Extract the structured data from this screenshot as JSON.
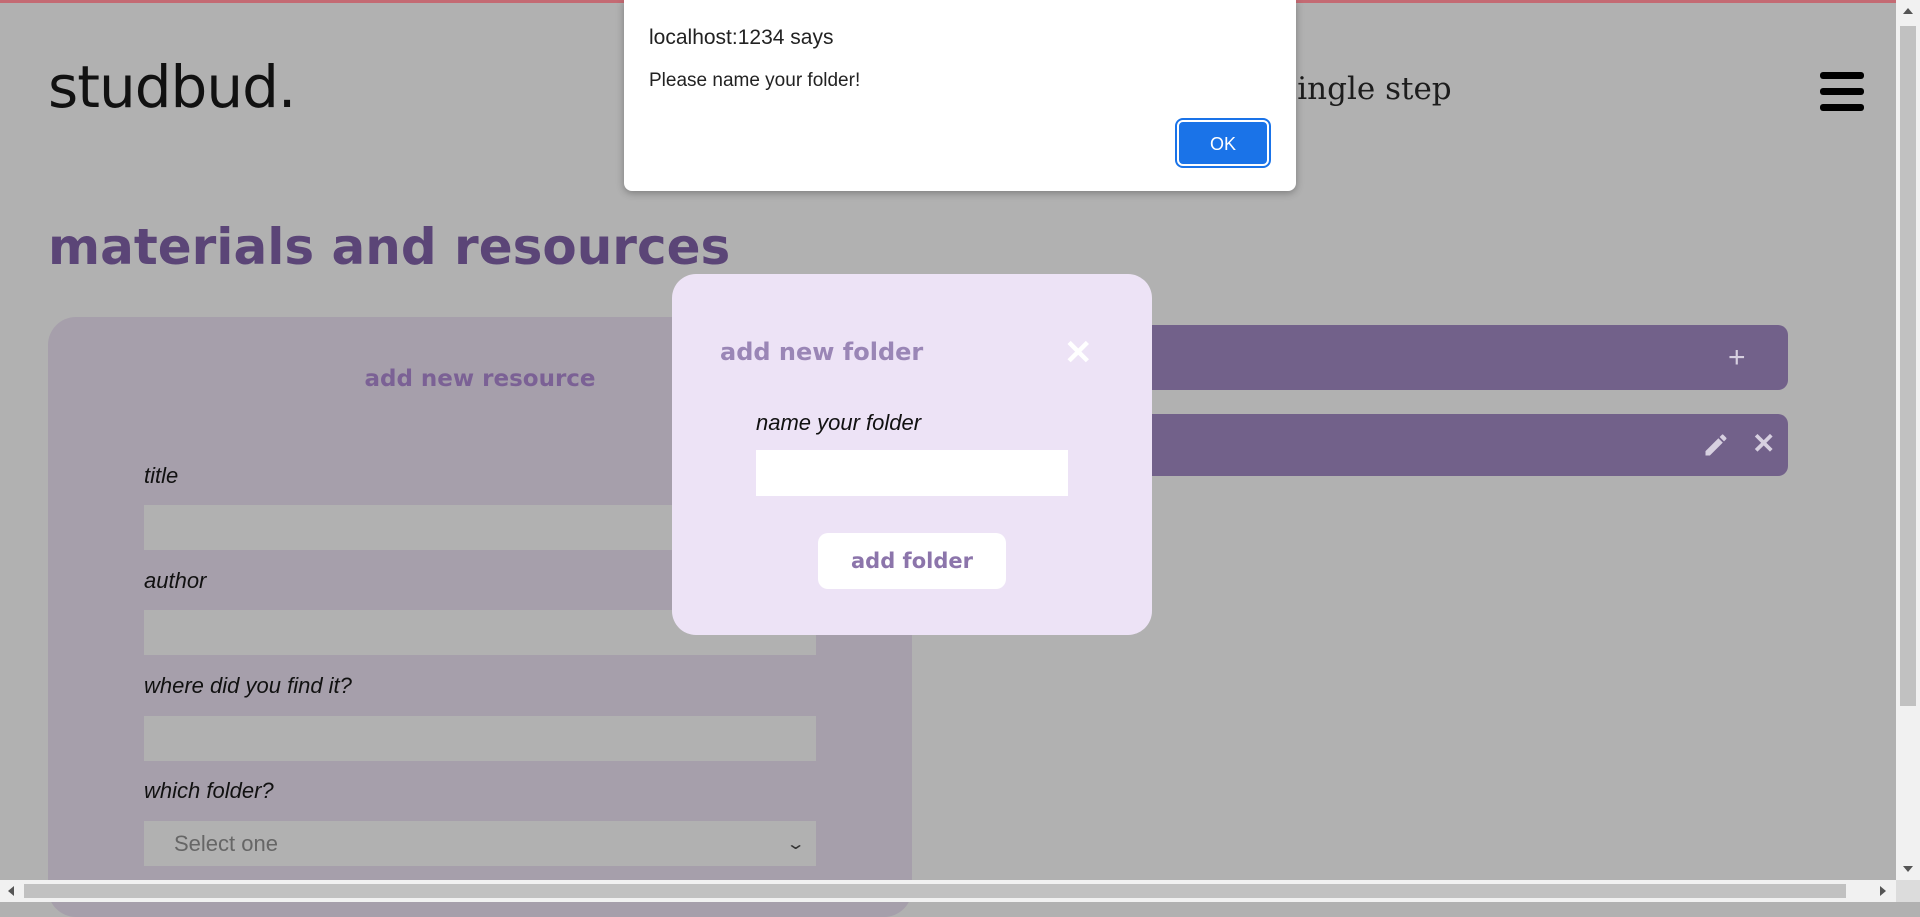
{
  "header": {
    "logo": "studbud.",
    "tagline": "a single step"
  },
  "page": {
    "title": "materials and resources"
  },
  "resource_form": {
    "title": "add new resource",
    "fields": {
      "title_label": "title",
      "author_label": "author",
      "source_label": "where did you find it?",
      "folder_label": "which folder?",
      "folder_selected": "Select one"
    }
  },
  "folder_modal": {
    "title": "add new folder",
    "name_label": "name your folder",
    "name_value": "",
    "submit_label": "add folder"
  },
  "alert": {
    "title": "localhost:1234 says",
    "message": "Please name your folder!",
    "ok_label": "OK"
  },
  "icons": {
    "add": "plus-icon",
    "edit": "pencil-icon",
    "delete": "close-icon",
    "menu": "hamburger-icon"
  },
  "colors": {
    "accent": "#5b4577",
    "folder_bar": "#72618a",
    "modal_bg": "#ede3f6",
    "alert_button": "#1a73e8"
  }
}
